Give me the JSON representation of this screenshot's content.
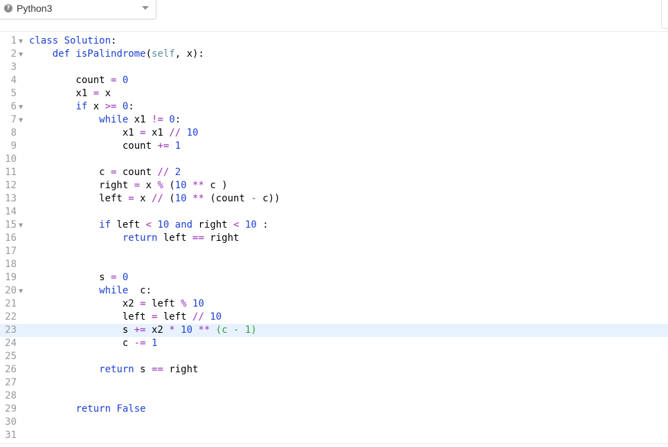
{
  "language_selector": {
    "label": "Python3",
    "icon": "question-circle-icon",
    "caret_icon": "caret-down-icon"
  },
  "editor": {
    "active_line": 23,
    "lines": [
      {
        "n": "1",
        "fold": true,
        "tokens": [
          [
            "kw",
            "class "
          ],
          [
            "def",
            "Solution"
          ],
          [
            "txt",
            ":"
          ]
        ]
      },
      {
        "n": "2",
        "fold": true,
        "tokens": [
          [
            "txt",
            "    "
          ],
          [
            "kw",
            "def "
          ],
          [
            "def",
            "isPalindrome"
          ],
          [
            "txt",
            "("
          ],
          [
            "self",
            "self"
          ],
          [
            "txt",
            ", x):"
          ]
        ]
      },
      {
        "n": "3",
        "fold": false,
        "tokens": []
      },
      {
        "n": "4",
        "fold": false,
        "tokens": [
          [
            "txt",
            "        count "
          ],
          [
            "op",
            "="
          ],
          [
            "txt",
            " "
          ],
          [
            "num",
            "0"
          ]
        ]
      },
      {
        "n": "5",
        "fold": false,
        "tokens": [
          [
            "txt",
            "        x1 "
          ],
          [
            "op",
            "="
          ],
          [
            "txt",
            " x"
          ]
        ]
      },
      {
        "n": "6",
        "fold": true,
        "tokens": [
          [
            "txt",
            "        "
          ],
          [
            "kw",
            "if"
          ],
          [
            "txt",
            " x "
          ],
          [
            "op",
            ">="
          ],
          [
            "txt",
            " "
          ],
          [
            "num",
            "0"
          ],
          [
            "txt",
            ":"
          ]
        ]
      },
      {
        "n": "7",
        "fold": true,
        "tokens": [
          [
            "txt",
            "            "
          ],
          [
            "kw",
            "while"
          ],
          [
            "txt",
            " x1 "
          ],
          [
            "op",
            "!="
          ],
          [
            "txt",
            " "
          ],
          [
            "num",
            "0"
          ],
          [
            "txt",
            ":"
          ]
        ]
      },
      {
        "n": "8",
        "fold": false,
        "tokens": [
          [
            "txt",
            "                x1 "
          ],
          [
            "op",
            "="
          ],
          [
            "txt",
            " x1 "
          ],
          [
            "op",
            "//"
          ],
          [
            "txt",
            " "
          ],
          [
            "num",
            "10"
          ]
        ]
      },
      {
        "n": "9",
        "fold": false,
        "tokens": [
          [
            "txt",
            "                count "
          ],
          [
            "op",
            "+="
          ],
          [
            "txt",
            " "
          ],
          [
            "num",
            "1"
          ]
        ]
      },
      {
        "n": "10",
        "fold": false,
        "tokens": []
      },
      {
        "n": "11",
        "fold": false,
        "tokens": [
          [
            "txt",
            "            c "
          ],
          [
            "op",
            "="
          ],
          [
            "txt",
            " count "
          ],
          [
            "op",
            "//"
          ],
          [
            "txt",
            " "
          ],
          [
            "num",
            "2"
          ]
        ]
      },
      {
        "n": "12",
        "fold": false,
        "tokens": [
          [
            "txt",
            "            right "
          ],
          [
            "op",
            "="
          ],
          [
            "txt",
            " x "
          ],
          [
            "op",
            "%"
          ],
          [
            "txt",
            " ("
          ],
          [
            "num",
            "10"
          ],
          [
            "txt",
            " "
          ],
          [
            "op",
            "**"
          ],
          [
            "txt",
            " c )"
          ]
        ]
      },
      {
        "n": "13",
        "fold": false,
        "tokens": [
          [
            "txt",
            "            left "
          ],
          [
            "op",
            "="
          ],
          [
            "txt",
            " x "
          ],
          [
            "op",
            "//"
          ],
          [
            "txt",
            " ("
          ],
          [
            "num",
            "10"
          ],
          [
            "txt",
            " "
          ],
          [
            "op",
            "**"
          ],
          [
            "txt",
            " (count "
          ],
          [
            "op",
            "-"
          ],
          [
            "txt",
            " c))"
          ]
        ]
      },
      {
        "n": "14",
        "fold": false,
        "tokens": []
      },
      {
        "n": "15",
        "fold": true,
        "tokens": [
          [
            "txt",
            "            "
          ],
          [
            "kw",
            "if"
          ],
          [
            "txt",
            " left "
          ],
          [
            "op",
            "<"
          ],
          [
            "txt",
            " "
          ],
          [
            "num",
            "10"
          ],
          [
            "txt",
            " "
          ],
          [
            "kw",
            "and"
          ],
          [
            "txt",
            " right "
          ],
          [
            "op",
            "<"
          ],
          [
            "txt",
            " "
          ],
          [
            "num",
            "10"
          ],
          [
            "txt",
            " :"
          ]
        ]
      },
      {
        "n": "16",
        "fold": false,
        "tokens": [
          [
            "txt",
            "                "
          ],
          [
            "kw",
            "return"
          ],
          [
            "txt",
            " left "
          ],
          [
            "op",
            "=="
          ],
          [
            "txt",
            " right"
          ]
        ]
      },
      {
        "n": "17",
        "fold": false,
        "tokens": []
      },
      {
        "n": "18",
        "fold": false,
        "tokens": []
      },
      {
        "n": "19",
        "fold": false,
        "tokens": [
          [
            "txt",
            "            s "
          ],
          [
            "op",
            "="
          ],
          [
            "txt",
            " "
          ],
          [
            "num",
            "0"
          ]
        ]
      },
      {
        "n": "20",
        "fold": true,
        "tokens": [
          [
            "txt",
            "            "
          ],
          [
            "kw",
            "while"
          ],
          [
            "txt",
            "  c:"
          ]
        ]
      },
      {
        "n": "21",
        "fold": false,
        "tokens": [
          [
            "txt",
            "                x2 "
          ],
          [
            "op",
            "="
          ],
          [
            "txt",
            " left "
          ],
          [
            "op",
            "%"
          ],
          [
            "txt",
            " "
          ],
          [
            "num",
            "10"
          ]
        ]
      },
      {
        "n": "22",
        "fold": false,
        "tokens": [
          [
            "txt",
            "                left "
          ],
          [
            "op",
            "="
          ],
          [
            "txt",
            " left "
          ],
          [
            "op",
            "//"
          ],
          [
            "txt",
            " "
          ],
          [
            "num",
            "10"
          ]
        ]
      },
      {
        "n": "23",
        "fold": false,
        "tokens": [
          [
            "txt",
            "                s "
          ],
          [
            "op",
            "+="
          ],
          [
            "txt",
            " x2 "
          ],
          [
            "op",
            "*"
          ],
          [
            "txt",
            " "
          ],
          [
            "num",
            "10"
          ],
          [
            "txt",
            " "
          ],
          [
            "op",
            "**"
          ],
          [
            "txt",
            " "
          ],
          [
            "grn",
            "(c - 1)"
          ]
        ]
      },
      {
        "n": "24",
        "fold": false,
        "tokens": [
          [
            "txt",
            "                c "
          ],
          [
            "op",
            "-="
          ],
          [
            "txt",
            " "
          ],
          [
            "num",
            "1"
          ]
        ]
      },
      {
        "n": "25",
        "fold": false,
        "tokens": []
      },
      {
        "n": "26",
        "fold": false,
        "tokens": [
          [
            "txt",
            "            "
          ],
          [
            "kw",
            "return"
          ],
          [
            "txt",
            " s "
          ],
          [
            "op",
            "=="
          ],
          [
            "txt",
            " right"
          ]
        ]
      },
      {
        "n": "27",
        "fold": false,
        "tokens": []
      },
      {
        "n": "28",
        "fold": false,
        "tokens": []
      },
      {
        "n": "29",
        "fold": false,
        "tokens": [
          [
            "txt",
            "        "
          ],
          [
            "kw",
            "return"
          ],
          [
            "txt",
            " "
          ],
          [
            "kw",
            "False"
          ]
        ]
      },
      {
        "n": "30",
        "fold": false,
        "tokens": []
      },
      {
        "n": "31",
        "fold": false,
        "tokens": []
      }
    ]
  }
}
